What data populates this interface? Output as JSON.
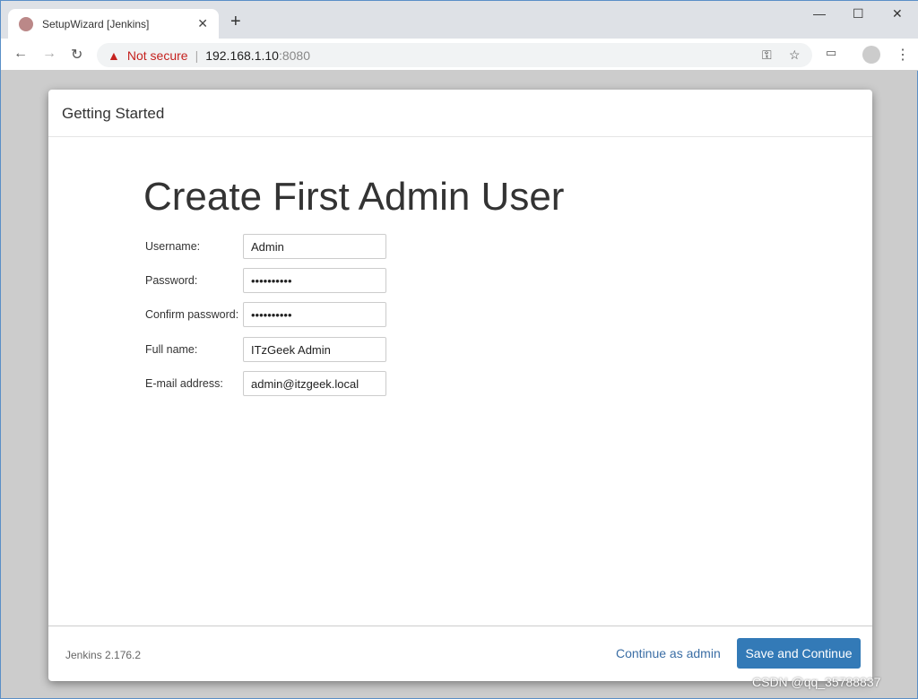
{
  "browser": {
    "tab_title": "SetupWizard [Jenkins]",
    "security_label": "Not secure",
    "url_host": "192.168.1.10",
    "url_port": ":8080"
  },
  "header": {
    "title": "Getting Started"
  },
  "main": {
    "heading": "Create First Admin User",
    "fields": [
      {
        "label": "Username:",
        "value": "Admin",
        "type": "text"
      },
      {
        "label": "Password:",
        "value": "••••••••••",
        "type": "password"
      },
      {
        "label": "Confirm password:",
        "value": "••••••••••",
        "type": "password"
      },
      {
        "label": "Full name:",
        "value": "ITzGeek Admin",
        "type": "text"
      },
      {
        "label": "E-mail address:",
        "value": "admin@itzgeek.local",
        "type": "text"
      }
    ]
  },
  "footer": {
    "version": "Jenkins 2.176.2",
    "continue_label": "Continue as admin",
    "save_label": "Save and Continue"
  },
  "watermark": "CSDN @qq_35788837",
  "colors": {
    "primary": "#337ab7",
    "warning": "#c5221f"
  }
}
